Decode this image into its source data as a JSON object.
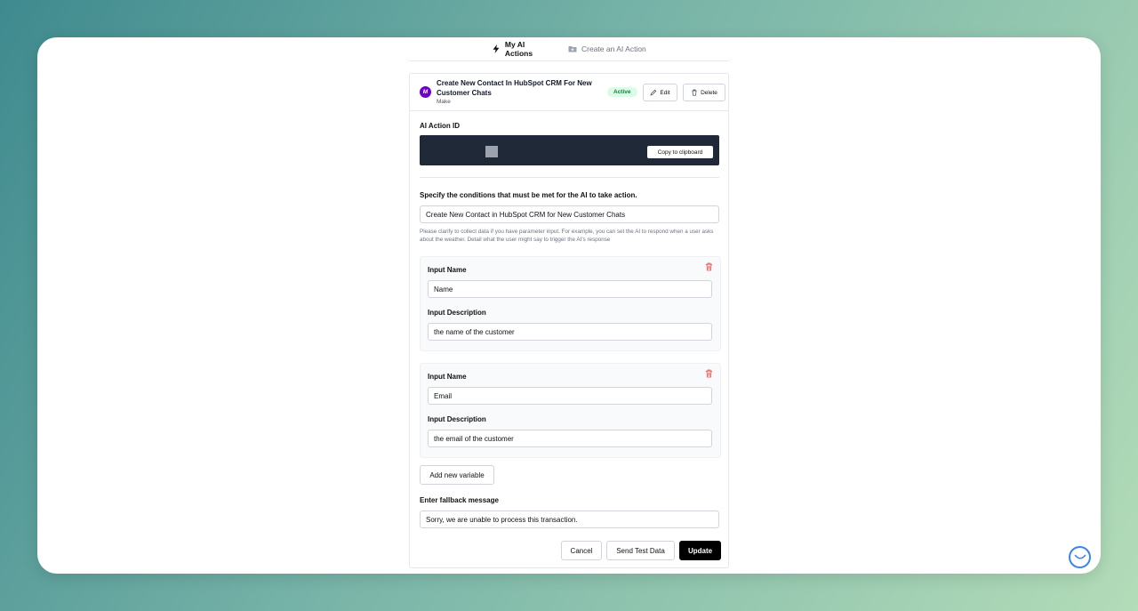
{
  "tabs": [
    {
      "label": "My AI Actions",
      "icon": "bolt-icon",
      "active": true
    },
    {
      "label": "Create an AI Action",
      "icon": "folder-plus-icon",
      "active": false
    }
  ],
  "action": {
    "title": "Create New Contact In HubSpot CRM For New Customer Chats",
    "app_name": "Make",
    "app_logo_text": "M",
    "status": "Active",
    "edit_label": "Edit",
    "delete_label": "Delete"
  },
  "ai_action_id": {
    "label": "AI Action ID",
    "copy_label": "Copy to clipboard"
  },
  "conditions": {
    "label": "Specify the conditions that must be met for the AI to take action.",
    "value": "Create New Contact in HubSpot CRM for New Customer Chats",
    "help": "Please clarify to collect data if you have parameter input. For example, you can set the AI to respond when a user asks about the weather. Detail what the user might say to trigger the AI's response"
  },
  "variables": [
    {
      "name_label": "Input Name",
      "name_value": "Name",
      "desc_label": "Input Description",
      "desc_value": "the name of the customer"
    },
    {
      "name_label": "Input Name",
      "name_value": "Email",
      "desc_label": "Input Description",
      "desc_value": "the email of the customer"
    }
  ],
  "add_variable_label": "Add new variable",
  "fallback": {
    "label": "Enter fallback message",
    "value": "Sorry, we are unable to process this transaction."
  },
  "footer": {
    "cancel_label": "Cancel",
    "test_label": "Send Test Data",
    "update_label": "Update"
  },
  "colors": {
    "accent": "#000000",
    "active_badge_bg": "#dcfce7",
    "active_badge_text": "#15803d",
    "id_box_bg": "#1f2937",
    "make_logo": "#6d00cc",
    "delete_icon": "#ef4444"
  }
}
